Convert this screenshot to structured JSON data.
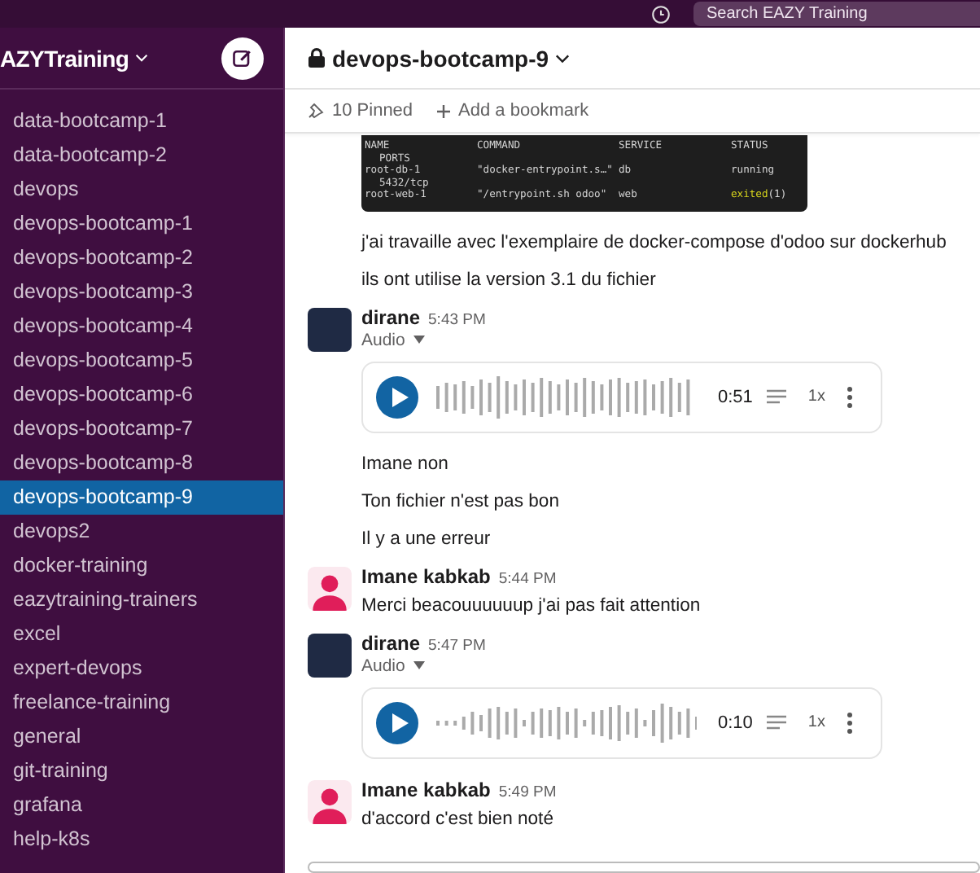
{
  "top_bar": {
    "search_placeholder": "Search EAZY Training"
  },
  "sidebar": {
    "workspace": "AZYTraining",
    "channels": [
      {
        "name": "data-bootcamp-1",
        "selected": false
      },
      {
        "name": "data-bootcamp-2",
        "selected": false
      },
      {
        "name": "devops",
        "selected": false
      },
      {
        "name": "devops-bootcamp-1",
        "selected": false
      },
      {
        "name": "devops-bootcamp-2",
        "selected": false
      },
      {
        "name": "devops-bootcamp-3",
        "selected": false
      },
      {
        "name": "devops-bootcamp-4",
        "selected": false
      },
      {
        "name": "devops-bootcamp-5",
        "selected": false
      },
      {
        "name": "devops-bootcamp-6",
        "selected": false
      },
      {
        "name": "devops-bootcamp-7",
        "selected": false
      },
      {
        "name": "devops-bootcamp-8",
        "selected": false
      },
      {
        "name": "devops-bootcamp-9",
        "selected": true
      },
      {
        "name": "devops2",
        "selected": false
      },
      {
        "name": "docker-training",
        "selected": false
      },
      {
        "name": "eazytraining-trainers",
        "selected": false
      },
      {
        "name": "excel",
        "selected": false
      },
      {
        "name": "expert-devops",
        "selected": false
      },
      {
        "name": "freelance-training",
        "selected": false
      },
      {
        "name": "general",
        "selected": false
      },
      {
        "name": "git-training",
        "selected": false
      },
      {
        "name": "grafana",
        "selected": false
      },
      {
        "name": "help-k8s",
        "selected": false
      }
    ]
  },
  "channel": {
    "title": "devops-bootcamp-9",
    "pinned": "10 Pinned",
    "add_bookmark": "Add a bookmark"
  },
  "terminal": {
    "columns": [
      "NAME",
      "COMMAND",
      "SERVICE",
      "STATUS"
    ],
    "subheader": "PORTS",
    "rows": [
      {
        "name": "root-db-1",
        "command": "\"docker-entrypoint.s…\"",
        "service": "db",
        "status": "running",
        "status_code": "",
        "color": "#d4d4d4",
        "ports": "5432/tcp"
      },
      {
        "name": "root-web-1",
        "command": "\"/entrypoint.sh odoo\"",
        "service": "web",
        "status": "exited",
        "status_code": "(1)",
        "color": "#d7d41c",
        "ports": ""
      }
    ]
  },
  "messages": [
    {
      "kind": "text",
      "text": "j'ai travaille avec l'exemplaire de docker-compose d'odoo sur dockerhub"
    },
    {
      "kind": "text",
      "text": "ils ont utilise la version 3.1 du fichier"
    },
    {
      "kind": "header",
      "author": "dirane",
      "time": "5:43 PM",
      "avatar_photo": true
    },
    {
      "kind": "audio",
      "label": "Audio",
      "duration": "0:51",
      "speed": "1x"
    },
    {
      "kind": "text",
      "text": "Imane non"
    },
    {
      "kind": "text",
      "text": "Ton fichier n'est pas bon"
    },
    {
      "kind": "text",
      "text": "Il y a une erreur"
    },
    {
      "kind": "header",
      "author": "Imane kabkab",
      "time": "5:44 PM",
      "avatar_photo": false
    },
    {
      "kind": "text",
      "text": "Merci beacouuuuuup j'ai pas fait attention"
    },
    {
      "kind": "header",
      "author": "dirane",
      "time": "5:47 PM",
      "avatar_photo": true
    },
    {
      "kind": "audio",
      "label": "Audio",
      "duration": "0:10",
      "speed": "1x"
    },
    {
      "kind": "header",
      "author": "Imane kabkab",
      "time": "5:49 PM",
      "avatar_photo": false
    },
    {
      "kind": "text",
      "text": "d'accord c'est bien noté"
    }
  ]
}
